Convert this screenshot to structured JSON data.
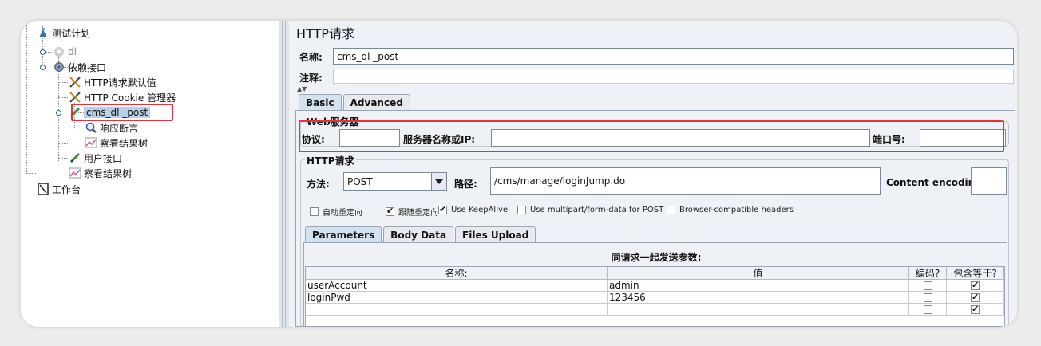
{
  "tree": {
    "items": [
      {
        "label": "测试计划",
        "icon": "test-plan-icon"
      },
      {
        "label": "dl",
        "icon": "gear-icon",
        "disabled": true
      },
      {
        "label": "依赖接口",
        "icon": "gear-icon"
      },
      {
        "label": "HTTP请求默认值",
        "icon": "wrench-icon"
      },
      {
        "label": "HTTP Cookie 管理器",
        "icon": "wrench-icon"
      },
      {
        "label": "cms_dl _post",
        "icon": "sampler-pen-icon",
        "selected": true
      },
      {
        "label": "响应断言",
        "icon": "magnifier-icon"
      },
      {
        "label": "察看结果树",
        "icon": "chart-icon"
      },
      {
        "label": "用户接口",
        "icon": "sampler-pen-icon"
      },
      {
        "label": "察看结果树",
        "icon": "chart-icon"
      },
      {
        "label": "工作台",
        "icon": "workbench-icon"
      }
    ]
  },
  "panel": {
    "title": "HTTP请求",
    "name_label": "名称:",
    "name_value": "cms_dl _post",
    "comment_label": "注释:",
    "tabs": [
      "Basic",
      "Advanced"
    ],
    "web_server": {
      "title": "Web服务器",
      "protocol_label": "协议:",
      "server_label": "服务器名称或IP:",
      "port_label": "端口号:",
      "protocol_value": "",
      "server_value": "",
      "port_value": ""
    },
    "http_request": {
      "title": "HTTP请求",
      "method_label": "方法:",
      "method_value": "POST",
      "path_label": "路径:",
      "path_value": "/cms/manage/loginJump.do",
      "encoding_label": "Content encoding:",
      "encoding_value": ""
    },
    "options": [
      {
        "label": "自动重定向",
        "checked": false
      },
      {
        "label": "跟随重定向",
        "checked": true
      },
      {
        "label": "Use KeepAlive",
        "checked": true
      },
      {
        "label": "Use multipart/form-data for POST",
        "checked": false
      },
      {
        "label": "Browser-compatible headers",
        "checked": false
      }
    ],
    "sub_tabs": [
      "Parameters",
      "Body Data",
      "Files Upload"
    ],
    "params": {
      "caption": "同请求一起发送参数:",
      "headers": [
        "名称:",
        "值",
        "编码?",
        "包含等于?"
      ],
      "rows": [
        {
          "name": "userAccount",
          "value": "admin",
          "encode": false,
          "include_equals": true
        },
        {
          "name": "loginPwd",
          "value": "123456",
          "encode": false,
          "include_equals": true
        },
        {
          "name": "",
          "value": "",
          "encode": false,
          "include_equals": true
        }
      ]
    }
  },
  "colors": {
    "highlight": "#e5323a",
    "selection": "#b8cfe5",
    "panel_bg": "#eef1f6"
  }
}
